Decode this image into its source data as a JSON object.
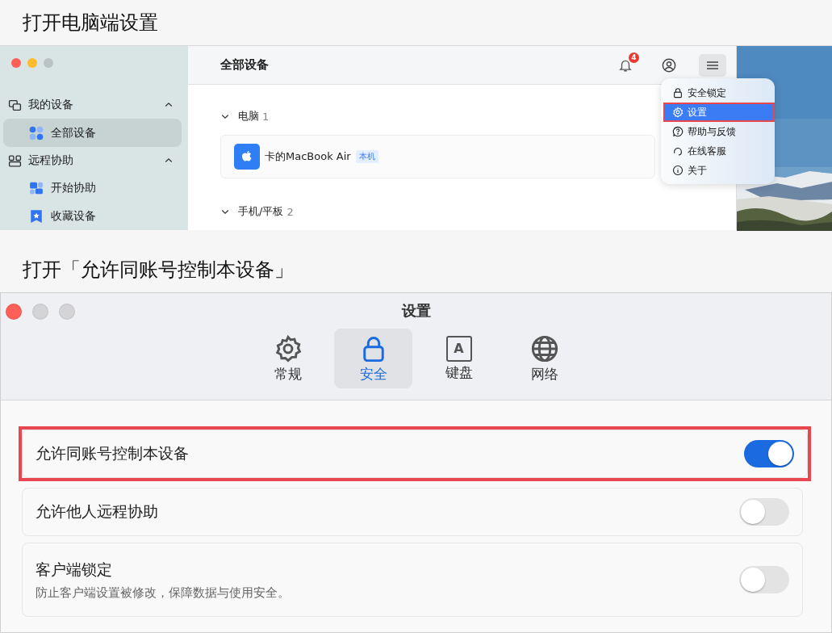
{
  "step_1": {
    "heading": "打开电脑端设置",
    "sidebar": {
      "groups": [
        {
          "kind": "devices",
          "label": "我的设备",
          "expanded": true,
          "items": [
            {
              "kind": "grid",
              "label": "全部设备",
              "selected": true
            }
          ]
        },
        {
          "kind": "remote",
          "label": "远程协助",
          "expanded": true,
          "items": [
            {
              "kind": "assist",
              "label": "开始协助",
              "selected": false
            },
            {
              "kind": "star",
              "label": "收藏设备",
              "selected": false
            }
          ]
        }
      ]
    },
    "header": {
      "title": "全部设备",
      "notification_count": "4"
    },
    "sections": [
      {
        "label": "电脑",
        "count": "1",
        "expanded": true,
        "devices": [
          {
            "name": "卡的MacBook Air",
            "tag": "本机"
          }
        ]
      },
      {
        "label": "手机/平板",
        "count": "2",
        "expanded": true
      }
    ],
    "menu": {
      "items": [
        {
          "kind": "lock",
          "label": "安全锁定",
          "selected": false,
          "highlighted": false
        },
        {
          "kind": "gear",
          "label": "设置",
          "selected": true,
          "highlighted": true
        },
        {
          "kind": "help",
          "label": "帮助与反馈",
          "selected": false,
          "highlighted": false
        },
        {
          "kind": "headset",
          "label": "在线客服",
          "selected": false,
          "highlighted": false
        },
        {
          "kind": "info",
          "label": "关于",
          "selected": false,
          "highlighted": false
        }
      ]
    }
  },
  "step_2": {
    "heading": "打开「允许同账号控制本设备」",
    "window": {
      "title": "设置"
    },
    "tabs": [
      {
        "kind": "gear",
        "label": "常规",
        "selected": false
      },
      {
        "kind": "lock",
        "label": "安全",
        "selected": true
      },
      {
        "kind": "keyboard",
        "icon_text": "A",
        "label": "键盘",
        "selected": false
      },
      {
        "kind": "globe",
        "label": "网络",
        "selected": false
      }
    ],
    "settings": [
      {
        "label": "允许同账号控制本设备",
        "on": true,
        "highlighted": true
      },
      {
        "label": "允许他人远程协助",
        "on": false,
        "highlighted": false
      },
      {
        "label": "客户端锁定",
        "description": "防止客户端设置被修改，保障数据与使用安全。",
        "on": false,
        "highlighted": false
      }
    ]
  }
}
